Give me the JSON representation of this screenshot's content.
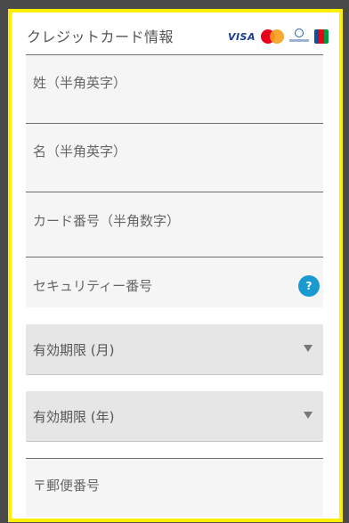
{
  "form": {
    "title": "クレジットカード情報",
    "brands": {
      "visa_label": "VISA",
      "mastercard_label": "MasterCard",
      "diners_label": "Diners Club",
      "jcb_label": "JCB"
    },
    "fields": {
      "last_name_placeholder": "姓（半角英字）",
      "first_name_placeholder": "名（半角英字）",
      "card_number_placeholder": "カード番号（半角数字）",
      "security_code_placeholder": "セキュリティー番号",
      "security_help_label": "?",
      "expiry_month_label": "有効期限 (月)",
      "expiry_year_label": "有効期限 (年)",
      "postal_code_placeholder": "〒郵便番号"
    }
  },
  "colors": {
    "frame_border": "#ffee00",
    "help_badge": "#1b9ad2"
  }
}
